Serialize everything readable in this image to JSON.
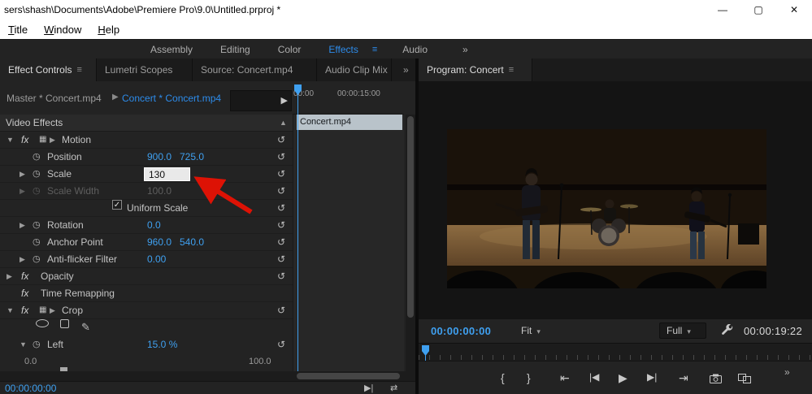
{
  "colors": {
    "accent_blue": "#2d8ceb",
    "value_blue": "#3fa0f0",
    "arrow_red": "#dd1205"
  },
  "titlebar": {
    "title": "sers\\shash\\Documents\\Adobe\\Premiere Pro\\9.0\\Untitled.prproj *",
    "minimize_icon": "—",
    "maximize_icon": "▢",
    "close_icon": "✕"
  },
  "menubar": {
    "items": [
      "Title",
      "Window",
      "Help"
    ]
  },
  "workspace": {
    "items": [
      "Assembly",
      "Editing",
      "Color",
      "Effects",
      "Audio"
    ],
    "active": "Effects",
    "menu_icon": "≡",
    "overflow_icon": "»"
  },
  "panel_tabs": {
    "effect_controls": "Effect Controls",
    "lumetri_scopes": "Lumetri Scopes",
    "source": "Source: Concert.mp4",
    "audio_clip_mixer": "Audio Clip Mix",
    "program": "Program: Concert",
    "menu_icon": "≡",
    "overflow_icon": "»"
  },
  "effect_controls": {
    "master_tab": "Master * Concert.mp4",
    "clip_tab": "Concert * Concert.mp4",
    "clip_tab_arrow": "▶",
    "nav_forward_icon": "▶",
    "section_video_effects": "Video Effects",
    "rows": {
      "motion": {
        "label": "Motion"
      },
      "position": {
        "label": "Position",
        "x": "900.0",
        "y": "725.0"
      },
      "scale": {
        "label": "Scale",
        "value": "130"
      },
      "scale_width": {
        "label": "Scale Width",
        "value": "100.0"
      },
      "uniform_scale": {
        "label": "Uniform Scale",
        "check": "✓"
      },
      "rotation": {
        "label": "Rotation",
        "value": "0.0"
      },
      "anchor_point": {
        "label": "Anchor Point",
        "x": "960.0",
        "y": "540.0"
      },
      "anti_flicker": {
        "label": "Anti-flicker Filter",
        "value": "0.00"
      },
      "opacity": {
        "label": "Opacity"
      },
      "time_remapping": {
        "label": "Time Remapping"
      },
      "crop": {
        "label": "Crop"
      },
      "left": {
        "label": "Left",
        "value": "15.0 %"
      },
      "slider": {
        "min": "0.0",
        "max": "100.0"
      }
    },
    "ruler": {
      "tick_start": "00:00",
      "tick_15": "00:00:15:00"
    },
    "clip_name": "Concert.mp4",
    "timecode": "00:00:00:00"
  },
  "program": {
    "current_timecode": "00:00:00:00",
    "zoom_level": "Fit",
    "playback_quality": "Full",
    "duration_timecode": "00:00:19:22"
  },
  "icons": {
    "expand": "▶",
    "collapsed": "▶",
    "expanded": "▼",
    "section_collapse": "▲",
    "fx": "fx",
    "clip_transform": "▦",
    "stopwatch": "◷",
    "reset": "↺",
    "pen": "✎",
    "caret_down": "▾",
    "ec_play": "▶|",
    "ec_loop": "⇄",
    "mark_in": "{",
    "mark_out": "}",
    "go_to_in": "⇤",
    "step_back": "|◀",
    "play": "▶",
    "step_forward": "▶|",
    "go_to_out": "⇥"
  }
}
